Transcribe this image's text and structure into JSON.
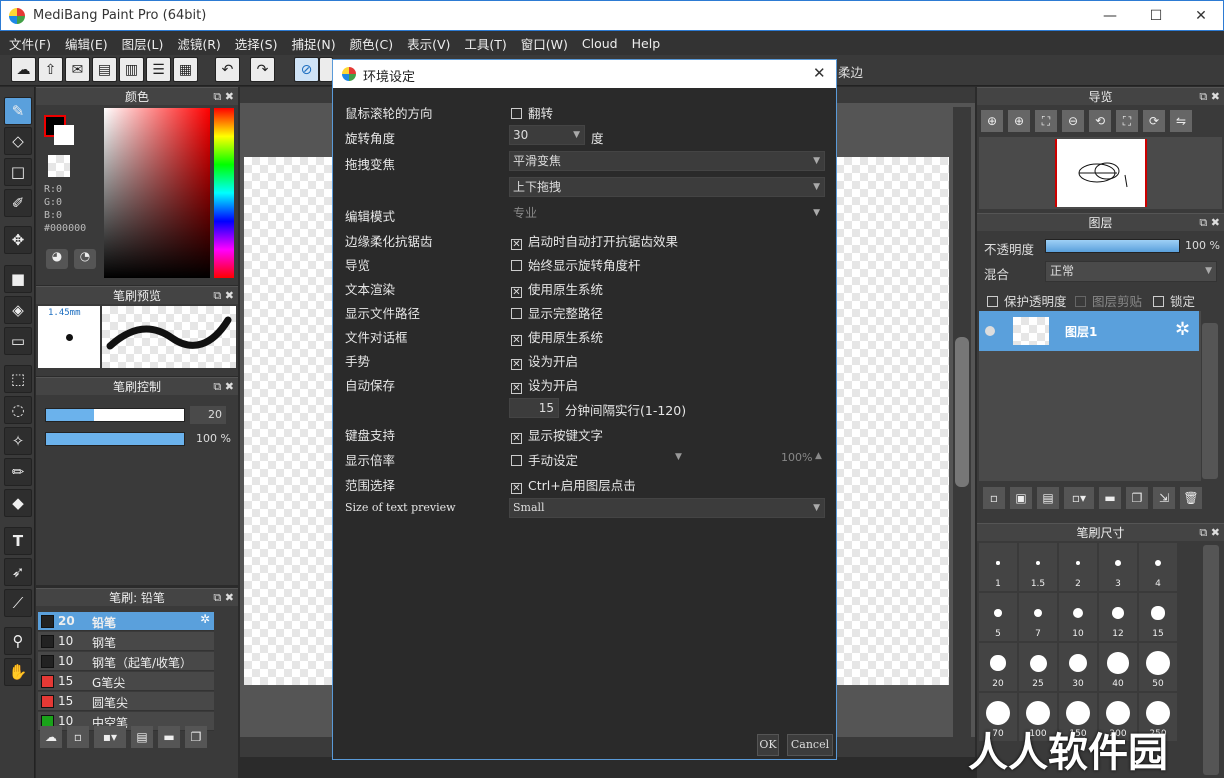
{
  "window": {
    "title": "MediBang Paint Pro (64bit)",
    "min": "—",
    "max": "☐",
    "close": "✕"
  },
  "menu": [
    "文件(F)",
    "编辑(E)",
    "图层(L)",
    "滤镜(R)",
    "选择(S)",
    "捕捉(N)",
    "颜色(C)",
    "表示(V)",
    "工具(T)",
    "窗口(W)",
    "Cloud",
    "Help"
  ],
  "toolbar": {
    "hidden_label": "柔边"
  },
  "color_panel": {
    "title": "颜色",
    "r": "R:0",
    "g": "G:0",
    "b": "B:0",
    "hex": "#000000"
  },
  "brush_preview": {
    "title": "笔刷预览",
    "size": "1.45mm"
  },
  "brush_control": {
    "title": "笔刷控制",
    "size_value": "20",
    "opacity_value": "100 %",
    "size_fill": 0.35,
    "opacity_fill": 1.0
  },
  "brush_list": {
    "title": "笔刷: 铅笔",
    "items": [
      {
        "size": "20",
        "name": "铅笔",
        "color": "#222222",
        "selected": true
      },
      {
        "size": "10",
        "name": "钢笔",
        "color": "#222222"
      },
      {
        "size": "10",
        "name": "钢笔（起笔/收笔）",
        "color": "#222222"
      },
      {
        "size": "15",
        "name": "G笔尖",
        "color": "#e53935"
      },
      {
        "size": "15",
        "name": "圆笔尖",
        "color": "#e53935"
      },
      {
        "size": "10",
        "name": "中空笔",
        "color": "#1aa31a"
      }
    ]
  },
  "dialog": {
    "title": "环境设定",
    "close": "✕",
    "rows": {
      "wheel_dir": "鼠标滚轮的方向",
      "wheel_val": "翻转",
      "rotate": "旋转角度",
      "rotate_val": "30",
      "rotate_unit": "度",
      "drag_zoom": "拖拽变焦",
      "drag_zoom_val": "平滑变焦",
      "drag_zoom_val2": "上下拖拽",
      "edit_mode": "编辑模式",
      "edit_mode_val": "专业",
      "antialias": "边缘柔化抗锯齿",
      "antialias_val": "启动时自动打开抗锯齿效果",
      "navigator": "导览",
      "navigator_val": "始终显示旋转角度杆",
      "text_render": "文本渲染",
      "text_render_val": "使用原生系统",
      "file_path": "显示文件路径",
      "file_path_val": "显示完整路径",
      "file_dialog": "文件对话框",
      "file_dialog_val": "使用原生系统",
      "gesture": "手势",
      "gesture_val": "设为开启",
      "autosave": "自动保存",
      "autosave_val": "设为开启",
      "autosave_min": "15",
      "autosave_unit": "分钟间隔实行(1-120)",
      "keyboard": "键盘支持",
      "keyboard_val": "显示按键文字",
      "zoom": "显示倍率",
      "zoom_val": "手动设定",
      "zoom_pct": "100%",
      "range": "范围选择",
      "range_val": "Ctrl+启用图层点击",
      "preview": "Size of text preview",
      "preview_val": "Small"
    },
    "ok": "OK",
    "cancel": "Cancel"
  },
  "navigator_panel": {
    "title": "导览"
  },
  "layer_panel": {
    "title": "图层",
    "opacity_label": "不透明度",
    "opacity_value": "100 %",
    "opacity_fill": 1.0,
    "blend_label": "混合",
    "blend_value": "正常",
    "protect": "保护透明度",
    "clip": "图层剪贴",
    "lock": "锁定",
    "layer_name": "图层1"
  },
  "brush_size_panel": {
    "title": "笔刷尺寸",
    "sizes": [
      "1",
      "1.5",
      "2",
      "3",
      "4",
      "5",
      "7",
      "10",
      "12",
      "15",
      "20",
      "25",
      "30",
      "40",
      "50",
      "70",
      "100",
      "150",
      "200",
      "250"
    ]
  },
  "watermark": "人人软件园"
}
